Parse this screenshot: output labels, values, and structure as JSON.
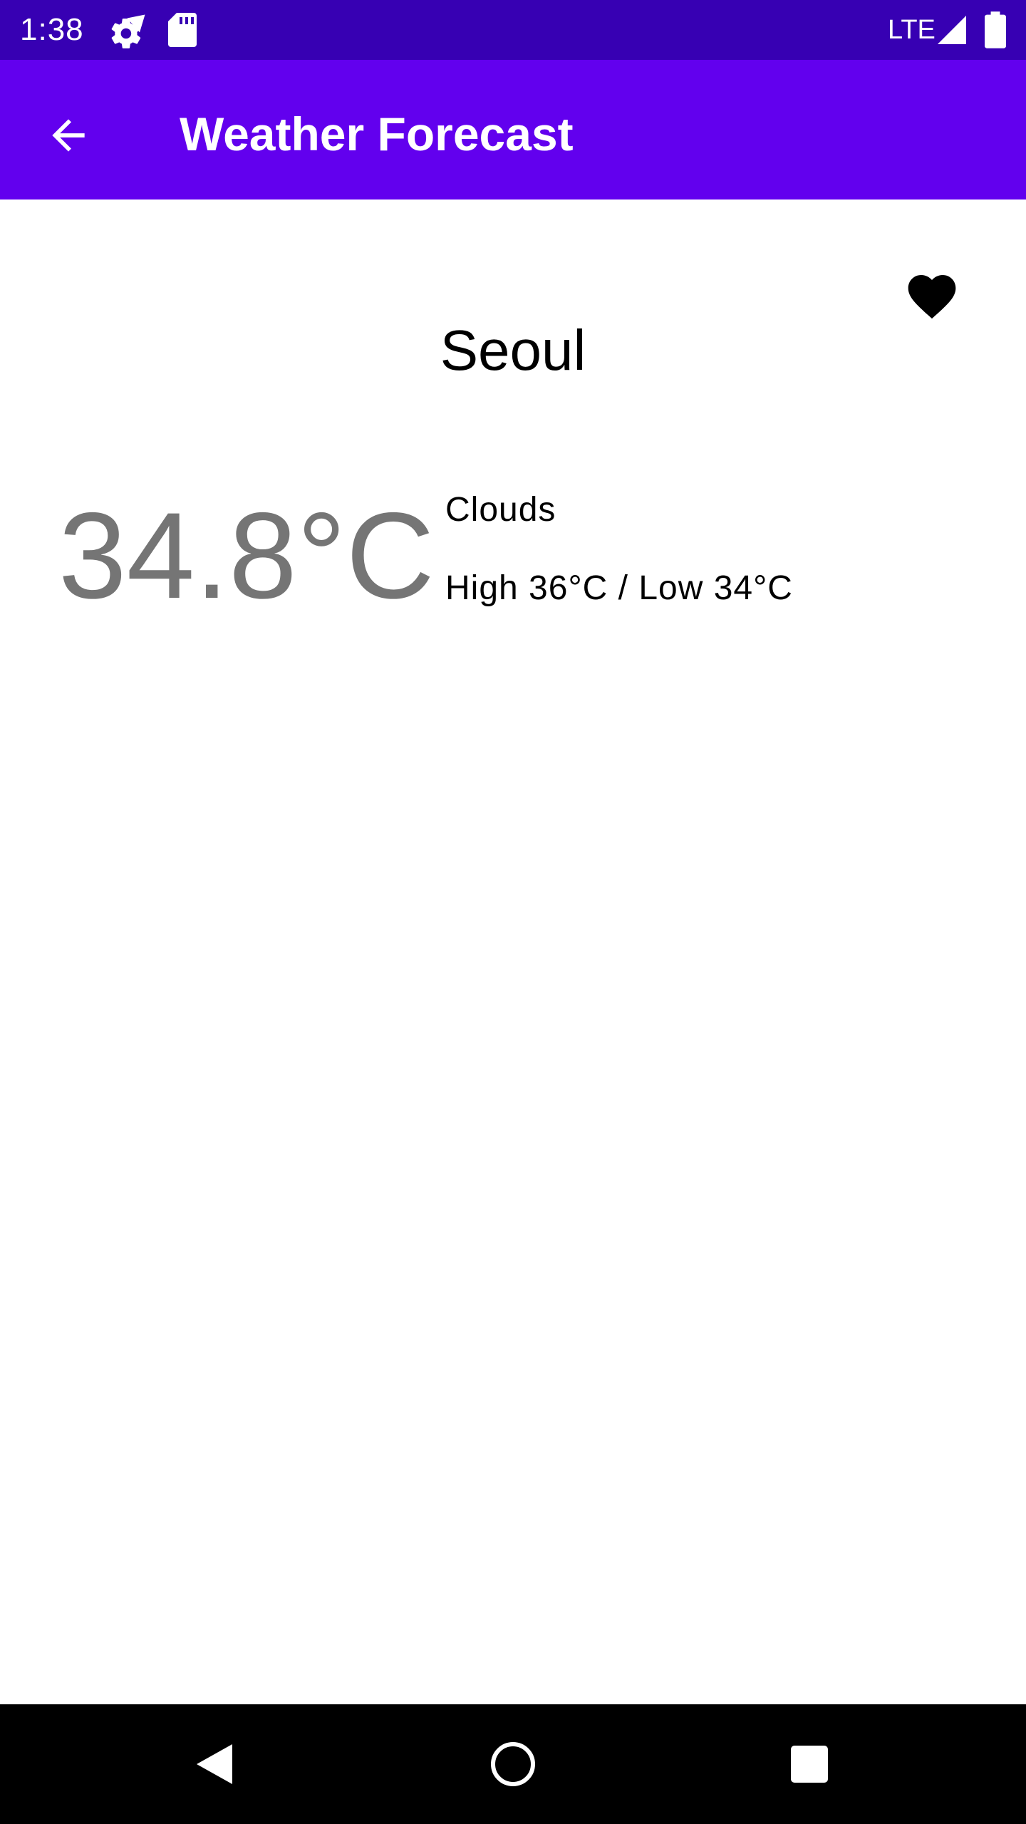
{
  "status_bar": {
    "time": "1:38",
    "network": "LTE",
    "icons": [
      "settings-icon",
      "sd-card-icon",
      "signal-icon",
      "battery-icon"
    ]
  },
  "app_bar": {
    "title": "Weather Forecast",
    "back_icon": "arrow-back-icon"
  },
  "weather": {
    "city": "Seoul",
    "temperature": "34.8°C",
    "condition": "Clouds",
    "high_low": "High 36°C / Low 34°C"
  },
  "favorite": {
    "icon": "heart-icon",
    "active": true
  },
  "nav_bar": {
    "icons": [
      "back-triangle-icon",
      "home-circle-icon",
      "recents-square-icon"
    ]
  },
  "colors": {
    "status_bar": "#3700b3",
    "app_bar": "#6200ee",
    "temperature_text": "#757575",
    "nav_bar": "#000000"
  }
}
